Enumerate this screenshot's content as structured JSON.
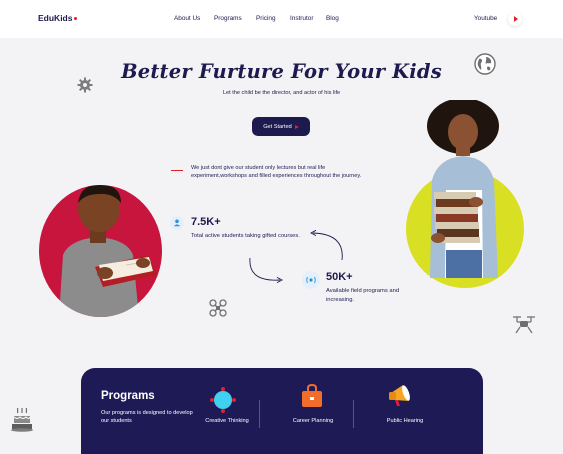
{
  "brand": {
    "name": "EduKids"
  },
  "nav": {
    "links": [
      "About Us",
      "Programs",
      "Pricing",
      "Instrutor",
      "Blog"
    ],
    "youtube_label": "Youtube"
  },
  "hero": {
    "title": "Better Furture For Your Kids",
    "subtitle": "Let the child be the director, and actor of his life",
    "cta_label": "Get Started"
  },
  "info": {
    "text": "We just dont give our student only lectures but real life experiment,workshops and filled experiences throughout the journey."
  },
  "stats": [
    {
      "value": "7.5K+",
      "label": "Total active students taking gifted courses."
    },
    {
      "value": "50K+",
      "label": "Available field programs and increasing."
    }
  ],
  "programs": {
    "title": "Programs",
    "description": "Our programs is designed to develop our students",
    "items": [
      {
        "label": "Creative Thinking",
        "icon": "creative-thinking-icon"
      },
      {
        "label": "Career Planning",
        "icon": "briefcase-icon"
      },
      {
        "label": "Public Hearing",
        "icon": "megaphone-icon"
      }
    ]
  },
  "colors": {
    "navy": "#1c1a4e",
    "accent_red": "#e0202d",
    "left_circle": "#c7153e",
    "right_circle": "#d9df22",
    "programs_bg": "#1d1a56"
  }
}
